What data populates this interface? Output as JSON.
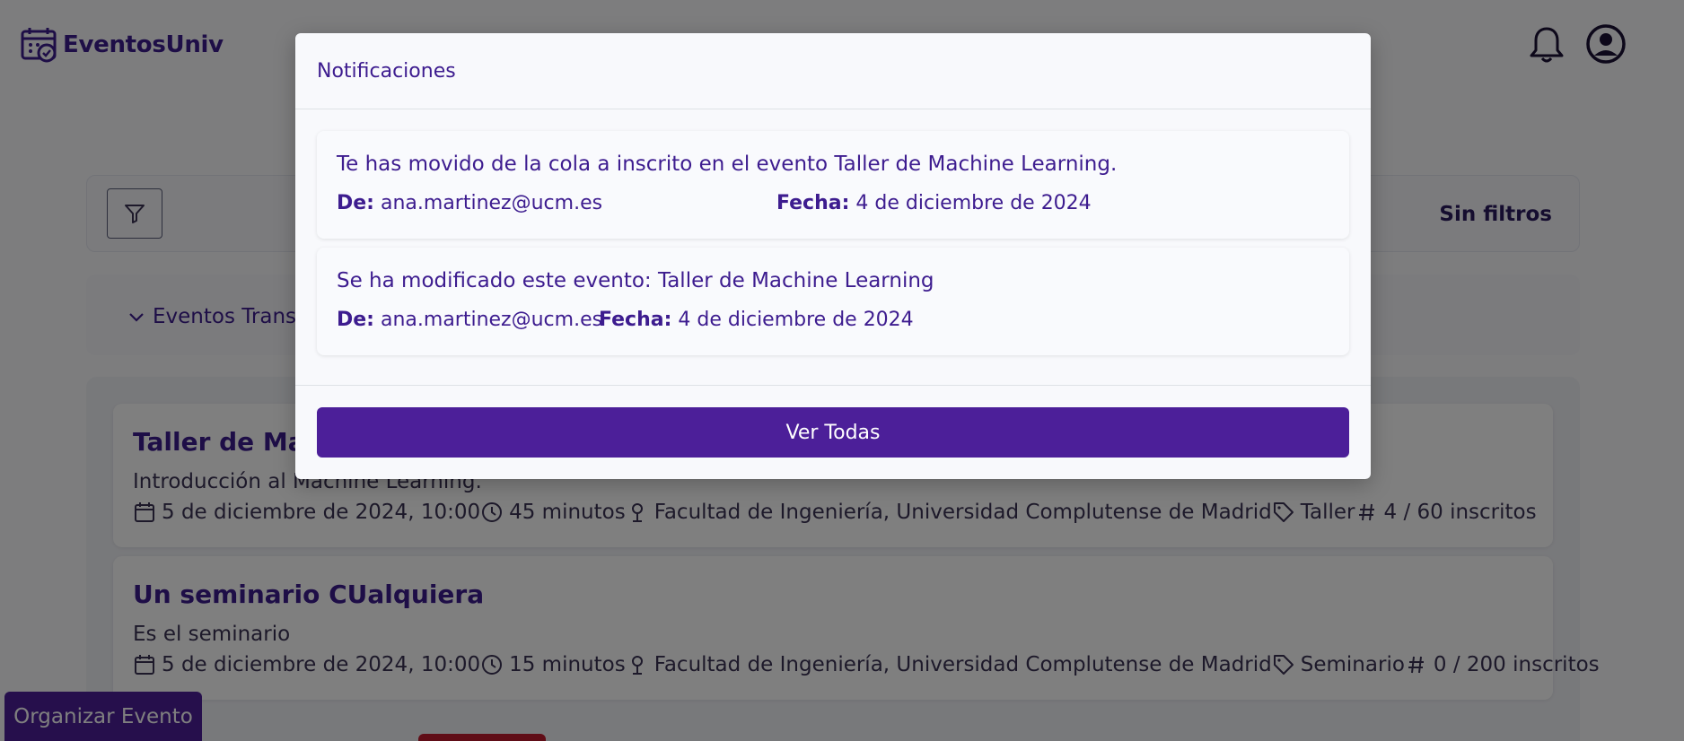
{
  "app": {
    "name": "EventosUniv"
  },
  "filters": {
    "status_label": "Sin filtros"
  },
  "sections": {
    "transcurridos_label": "Eventos Transc"
  },
  "events": [
    {
      "title": "Taller de Mac",
      "description": "Introducción al Machine Learning.",
      "date": "5 de diciembre de 2024, 10:00",
      "duration": "45 minutos",
      "location": "Facultad de Ingeniería, Universidad Complutense de Madrid",
      "type": "Taller",
      "capacity": "4 / 60 inscritos"
    },
    {
      "title": "Un seminario CUalquiera",
      "description": "Es el seminario",
      "date": "5 de diciembre de 2024, 10:00",
      "duration": "15 minutos",
      "location": "Facultad de Ingeniería, Universidad Complutense de Madrid",
      "type": "Seminario",
      "capacity": "0 / 200 inscritos"
    }
  ],
  "organize_button": "Organizar Evento",
  "modal": {
    "title": "Notificaciones",
    "from_label": "De:",
    "date_label": "Fecha:",
    "notifications": [
      {
        "message": "Te has movido de la cola a inscrito en el evento Taller de Machine Learning.",
        "from": "ana.martinez@ucm.es",
        "date": "4 de diciembre de 2024"
      },
      {
        "message": "Se ha modificado este evento: Taller de Machine Learning",
        "from": "ana.martinez@ucm.es",
        "date": "4 de diciembre de 2024"
      }
    ],
    "see_all_label": "Ver Todas"
  },
  "colors": {
    "accent": "#4c1f99",
    "text": "#3d1c8f",
    "overlay": "rgba(0,0,0,0.5)"
  }
}
